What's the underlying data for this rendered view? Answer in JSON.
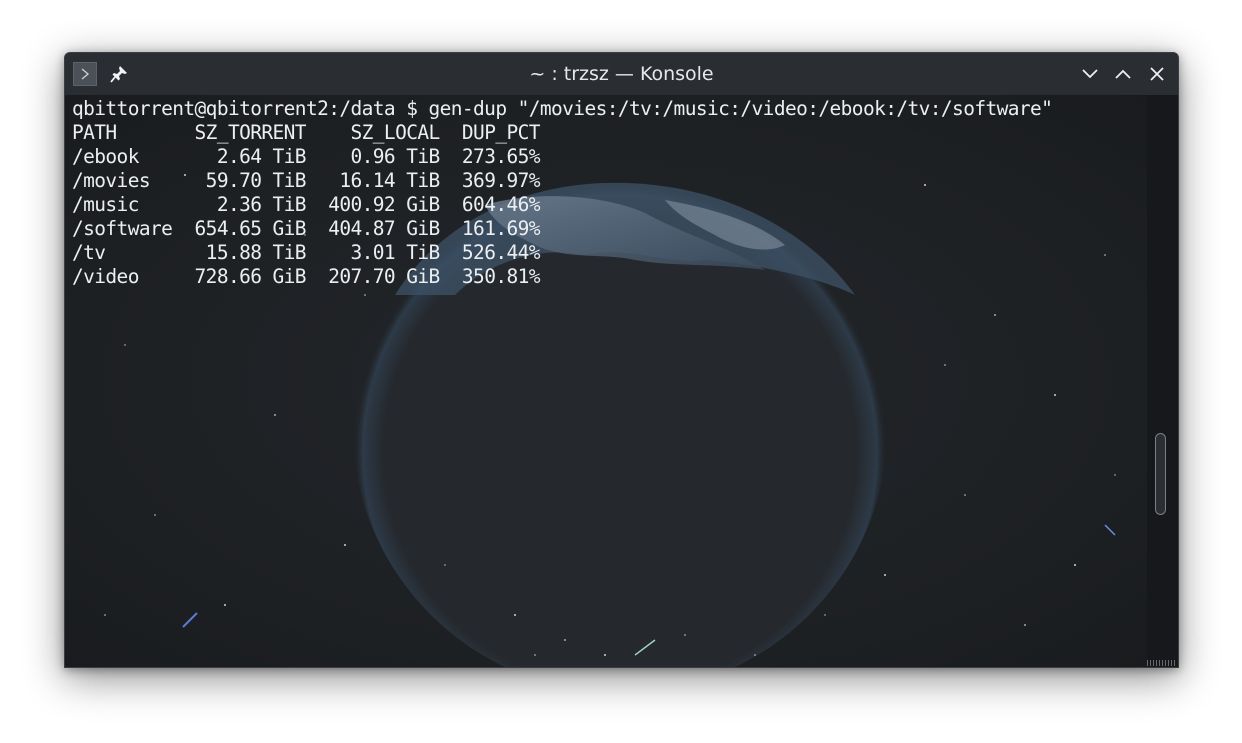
{
  "window": {
    "title": "~ : trzsz — Konsole"
  },
  "icons": {
    "app": "terminal-prompt-icon",
    "pin": "pin-icon",
    "minimize": "chevron-down-icon",
    "maximize": "chevron-up-icon",
    "close": "close-x-icon"
  },
  "terminal": {
    "command_line": "qbittorrent@qbitorrent2:/data $ gen-dup \"/movies:/tv:/music:/video:/ebook:/tv:/software\"",
    "table": {
      "headers": [
        "PATH",
        "SZ_TORRENT",
        "SZ_LOCAL",
        "DUP_PCT"
      ],
      "rows": [
        [
          "/ebook",
          "2.64 TiB",
          "0.96 TiB",
          "273.65%"
        ],
        [
          "/movies",
          "59.70 TiB",
          "16.14 TiB",
          "369.97%"
        ],
        [
          "/music",
          "2.36 TiB",
          "400.92 GiB",
          "604.46%"
        ],
        [
          "/software",
          "654.65 GiB",
          "404.87 GiB",
          "161.69%"
        ],
        [
          "/tv",
          "15.88 TiB",
          "3.01 TiB",
          "526.44%"
        ],
        [
          "/video",
          "728.66 GiB",
          "207.70 GiB",
          "350.81%"
        ]
      ]
    }
  },
  "colors": {
    "titlebar": "#2a2e32",
    "terminal_bg": "#1e2124",
    "text": "#eceff1"
  }
}
